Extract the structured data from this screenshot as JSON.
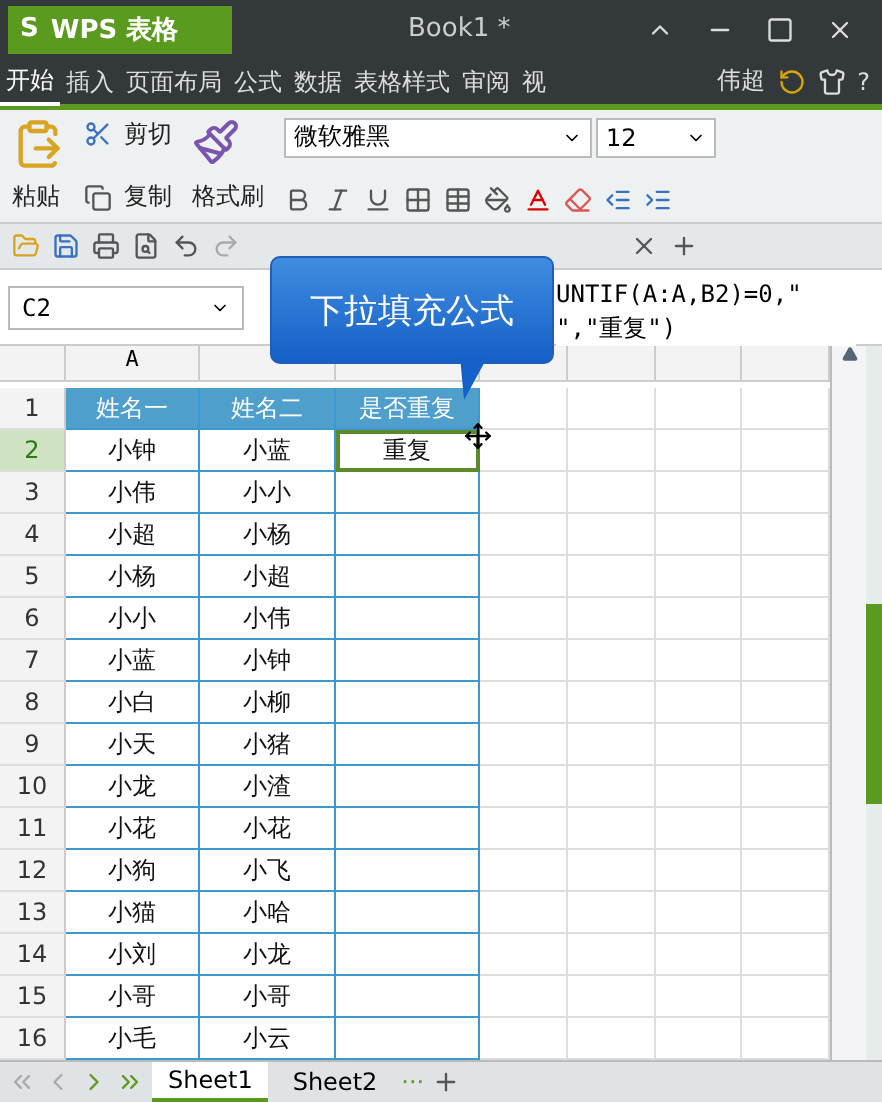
{
  "app": {
    "logo": "S",
    "name": "WPS 表格",
    "document": "Book1 *"
  },
  "menu": [
    {
      "label": "开始",
      "selected": true
    },
    {
      "label": "插入",
      "selected": false
    },
    {
      "label": "页面布局",
      "selected": false
    },
    {
      "label": "公式",
      "selected": false
    },
    {
      "label": "数据",
      "selected": false
    },
    {
      "label": "表格样式",
      "selected": false
    },
    {
      "label": "审阅",
      "selected": false
    },
    {
      "label": "视",
      "selected": false
    }
  ],
  "user": "伟超",
  "help": "?",
  "ribbon": {
    "paste": "粘贴",
    "cut": "剪切",
    "copy": "复制",
    "format_painter": "格式刷",
    "font": "微软雅黑",
    "size": "12"
  },
  "name_box": "C2",
  "formula": [
    "UNTIF(A:A,B2)=0,\"",
    "\",\"重复\")"
  ],
  "callout": "下拉填充公式",
  "column_headers": [
    "A"
  ],
  "rows": [
    {
      "n": "1",
      "cells": [
        "姓名一",
        "姓名二",
        "是否重复"
      ],
      "header": true,
      "selected": false
    },
    {
      "n": "2",
      "cells": [
        "小钟",
        "小蓝",
        "重复"
      ],
      "header": false,
      "selected": true
    },
    {
      "n": "3",
      "cells": [
        "小伟",
        "小小",
        ""
      ],
      "header": false,
      "selected": false
    },
    {
      "n": "4",
      "cells": [
        "小超",
        "小杨",
        ""
      ],
      "header": false,
      "selected": false
    },
    {
      "n": "5",
      "cells": [
        "小杨",
        "小超",
        ""
      ],
      "header": false,
      "selected": false
    },
    {
      "n": "6",
      "cells": [
        "小小",
        "小伟",
        ""
      ],
      "header": false,
      "selected": false
    },
    {
      "n": "7",
      "cells": [
        "小蓝",
        "小钟",
        ""
      ],
      "header": false,
      "selected": false
    },
    {
      "n": "8",
      "cells": [
        "小白",
        "小柳",
        ""
      ],
      "header": false,
      "selected": false
    },
    {
      "n": "9",
      "cells": [
        "小天",
        "小猪",
        ""
      ],
      "header": false,
      "selected": false
    },
    {
      "n": "10",
      "cells": [
        "小龙",
        "小渣",
        ""
      ],
      "header": false,
      "selected": false
    },
    {
      "n": "11",
      "cells": [
        "小花",
        "小花",
        ""
      ],
      "header": false,
      "selected": false
    },
    {
      "n": "12",
      "cells": [
        "小狗",
        "小飞",
        ""
      ],
      "header": false,
      "selected": false
    },
    {
      "n": "13",
      "cells": [
        "小猫",
        "小哈",
        ""
      ],
      "header": false,
      "selected": false
    },
    {
      "n": "14",
      "cells": [
        "小刘",
        "小龙",
        ""
      ],
      "header": false,
      "selected": false
    },
    {
      "n": "15",
      "cells": [
        "小哥",
        "小哥",
        ""
      ],
      "header": false,
      "selected": false
    },
    {
      "n": "16",
      "cells": [
        "小毛",
        "小云",
        ""
      ],
      "header": false,
      "selected": false
    }
  ],
  "sheets": [
    {
      "label": "Sheet1",
      "selected": true
    },
    {
      "label": "Sheet2",
      "selected": false
    }
  ],
  "sheet_more": "···"
}
